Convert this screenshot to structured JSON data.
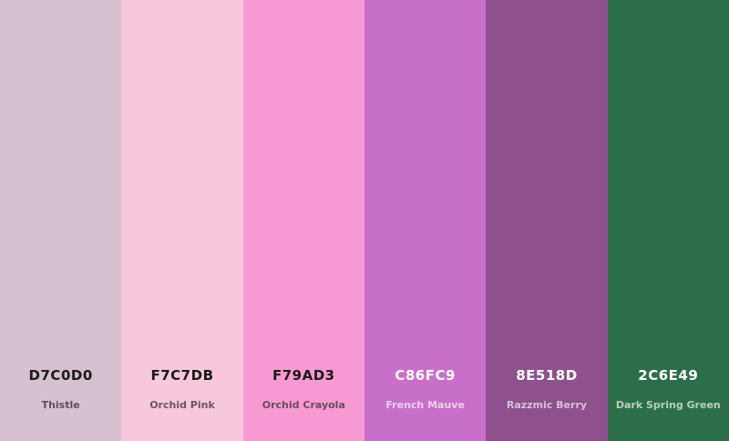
{
  "swatches": [
    {
      "hex": "D7C0D0",
      "name": "Thistle",
      "color": "#D7C0D0",
      "hex_color": "#1a1a1a",
      "name_color": "#5a5058"
    },
    {
      "hex": "F7C7DB",
      "name": "Orchid Pink",
      "color": "#F7C7DB",
      "hex_color": "#1a1a1a",
      "name_color": "#6a5560"
    },
    {
      "hex": "F79AD3",
      "name": "Orchid Crayola",
      "color": "#F79AD3",
      "hex_color": "#1a1a1a",
      "name_color": "#6a4a60"
    },
    {
      "hex": "C86FC9",
      "name": "French Mauve",
      "color": "#C86FC9",
      "hex_color": "#ffffff",
      "name_color": "#ecd0ec"
    },
    {
      "hex": "8E518D",
      "name": "Razzmic Berry",
      "color": "#8E518D",
      "hex_color": "#ffffff",
      "name_color": "#d8c0d8"
    },
    {
      "hex": "2C6E49",
      "name": "Dark Spring Green",
      "color": "#2C6E49",
      "hex_color": "#ffffff",
      "name_color": "#b8d0c0"
    }
  ]
}
